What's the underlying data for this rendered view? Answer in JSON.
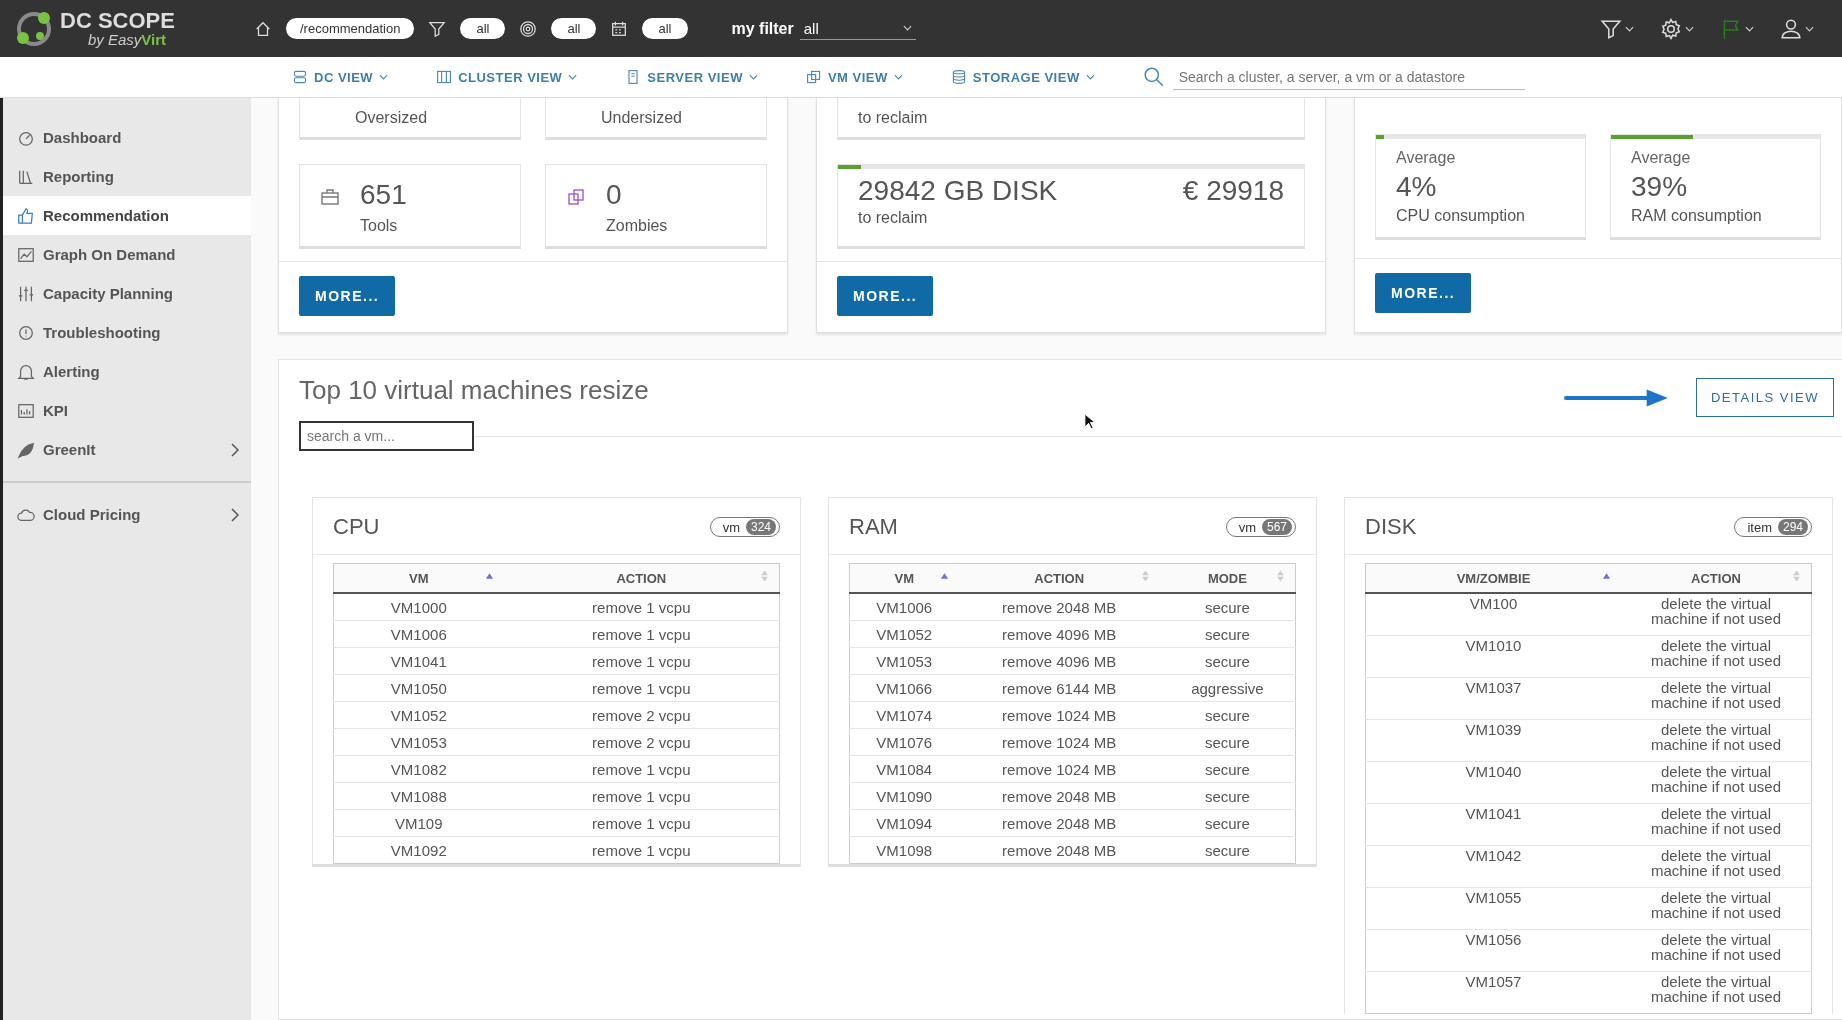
{
  "brand": {
    "name": "DC SCOPE",
    "tagline": [
      "by Easy",
      "Virt"
    ]
  },
  "topbar": {
    "path": "/recommendation",
    "filters": [
      {
        "value": "all"
      },
      {
        "value": "all"
      },
      {
        "value": "all"
      }
    ],
    "my_filter": {
      "label": "my filter",
      "value": "all"
    }
  },
  "nav": {
    "items": [
      {
        "label": "DC VIEW"
      },
      {
        "label": "CLUSTER VIEW"
      },
      {
        "label": "SERVER VIEW"
      },
      {
        "label": "VM VIEW"
      },
      {
        "label": "STORAGE VIEW"
      }
    ],
    "search": {
      "placeholder": "Search a cluster, a server, a vm or a datastore"
    }
  },
  "sidebar": {
    "items": [
      {
        "label": "Dashboard",
        "selected": false,
        "has_submenu": false
      },
      {
        "label": "Reporting",
        "selected": false,
        "has_submenu": false
      },
      {
        "label": "Recommendation",
        "selected": true,
        "has_submenu": false
      },
      {
        "label": "Graph On Demand",
        "selected": false,
        "has_submenu": false
      },
      {
        "label": "Capacity Planning",
        "selected": false,
        "has_submenu": false
      },
      {
        "label": "Troubleshooting",
        "selected": false,
        "has_submenu": false
      },
      {
        "label": "Alerting",
        "selected": false,
        "has_submenu": false
      },
      {
        "label": "KPI",
        "selected": false,
        "has_submenu": false
      },
      {
        "label": "GreenIt",
        "selected": false,
        "has_submenu": true
      },
      {
        "label": "Cloud Pricing",
        "selected": false,
        "has_submenu": true
      }
    ]
  },
  "summary_panels": [
    {
      "tiles": [
        {
          "kind": "cut",
          "label": "Oversized"
        },
        {
          "kind": "cut",
          "label": "Undersized"
        },
        {
          "kind": "count",
          "value": "651",
          "label": "Tools"
        },
        {
          "kind": "count",
          "value": "0",
          "label": "Zombies"
        }
      ],
      "button": "MORE..."
    },
    {
      "tiles": [
        {
          "kind": "cut",
          "label": "to reclaim"
        },
        {
          "kind": "reclaim",
          "value": "29842 GB DISK",
          "price": "€ 29918",
          "label": "to reclaim",
          "level": 0.05
        }
      ],
      "button": "MORE..."
    },
    {
      "tiles": [
        {
          "kind": "average",
          "caption": "Average",
          "value": "4%",
          "label": "CPU consumption",
          "level": 0.04
        },
        {
          "kind": "average",
          "caption": "Average",
          "value": "39%",
          "label": "RAM consumption",
          "level": 0.39
        }
      ],
      "button": "MORE..."
    }
  ],
  "resize": {
    "title": "Top 10 virtual machines resize",
    "details_button": "DETAILS VIEW",
    "search": {
      "placeholder": "search a vm..."
    },
    "tables": [
      {
        "title": "CPU",
        "badge_label": "vm",
        "badge_count": "324",
        "columns": [
          {
            "label": "VM",
            "sorted": true
          },
          {
            "label": "ACTION",
            "sorted": false
          }
        ],
        "rows": [
          [
            "VM1000",
            "remove 1 vcpu"
          ],
          [
            "VM1006",
            "remove 1 vcpu"
          ],
          [
            "VM1041",
            "remove 1 vcpu"
          ],
          [
            "VM1050",
            "remove 1 vcpu"
          ],
          [
            "VM1052",
            "remove 2 vcpu"
          ],
          [
            "VM1053",
            "remove 2 vcpu"
          ],
          [
            "VM1082",
            "remove 1 vcpu"
          ],
          [
            "VM1088",
            "remove 1 vcpu"
          ],
          [
            "VM109",
            "remove 1 vcpu"
          ],
          [
            "VM1092",
            "remove 1 vcpu"
          ]
        ]
      },
      {
        "title": "RAM",
        "badge_label": "vm",
        "badge_count": "567",
        "columns": [
          {
            "label": "VM",
            "sorted": true
          },
          {
            "label": "ACTION",
            "sorted": false
          },
          {
            "label": "MODE",
            "sorted": false
          }
        ],
        "rows": [
          [
            "VM1006",
            "remove 2048 MB",
            "secure"
          ],
          [
            "VM1052",
            "remove 4096 MB",
            "secure"
          ],
          [
            "VM1053",
            "remove 4096 MB",
            "secure"
          ],
          [
            "VM1066",
            "remove 6144 MB",
            "aggressive"
          ],
          [
            "VM1074",
            "remove 1024 MB",
            "secure"
          ],
          [
            "VM1076",
            "remove 1024 MB",
            "secure"
          ],
          [
            "VM1084",
            "remove 1024 MB",
            "secure"
          ],
          [
            "VM1090",
            "remove 2048 MB",
            "secure"
          ],
          [
            "VM1094",
            "remove 2048 MB",
            "secure"
          ],
          [
            "VM1098",
            "remove 2048 MB",
            "secure"
          ]
        ]
      },
      {
        "title": "DISK",
        "badge_label": "item",
        "badge_count": "294",
        "columns": [
          {
            "label": "VM/ZOMBIE",
            "sorted": true
          },
          {
            "label": "ACTION",
            "sorted": false
          }
        ],
        "rows": [
          [
            "VM100",
            "delete the virtual machine if not used"
          ],
          [
            "VM1010",
            "delete the virtual machine if not used"
          ],
          [
            "VM1037",
            "delete the virtual machine if not used"
          ],
          [
            "VM1039",
            "delete the virtual machine if not used"
          ],
          [
            "VM1040",
            "delete the virtual machine if not used"
          ],
          [
            "VM1041",
            "delete the virtual machine if not used"
          ],
          [
            "VM1042",
            "delete the virtual machine if not used"
          ],
          [
            "VM1055",
            "delete the virtual machine if not used"
          ],
          [
            "VM1056",
            "delete the virtual machine if not used"
          ],
          [
            "VM1057",
            "delete the virtual machine if not used"
          ]
        ]
      }
    ]
  }
}
